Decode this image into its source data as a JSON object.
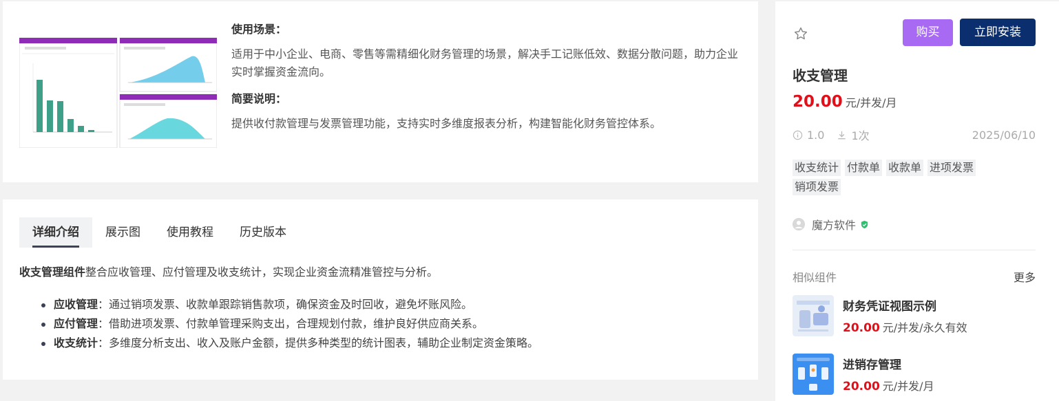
{
  "usage": {
    "scene_title": "使用场景：",
    "scene_text": "适用于中小企业、电商、零售等需精细化财务管理的场景，解决手工记账低效、数据分散问题，助力企业实时掌握资金流向。",
    "brief_title": "简要说明：",
    "brief_text": "提供收付款管理与发票管理功能，支持实时多维度报表分析，构建智能化财务管控体系。"
  },
  "tabs": [
    {
      "label": "详细介绍",
      "active": true
    },
    {
      "label": "展示图",
      "active": false
    },
    {
      "label": "使用教程",
      "active": false
    },
    {
      "label": "历史版本",
      "active": false
    }
  ],
  "detail": {
    "intro_bold": "收支管理组件",
    "intro_rest": "整合应收管理、应付管理及收支统计，实现企业资金流精准管控与分析。",
    "bullets": [
      {
        "bold": "应收管理",
        "text": "：通过销项发票、收款单跟踪销售款项，确保资金及时回收，避免坏账风险。"
      },
      {
        "bold": "应付管理",
        "text": "：借助进项发票、付款单管理采购支出，合理规划付款，维护良好供应商关系。"
      },
      {
        "bold": "收支统计",
        "text": "：多维度分析支出、收入及账户金额，提供多种类型的统计图表，辅助企业制定资金策略。"
      }
    ]
  },
  "product": {
    "buy_label": "购买",
    "install_label": "立即安装",
    "title": "收支管理",
    "price": "20.00",
    "unit": "元/并发/月",
    "version": "1.0",
    "downloads": "1次",
    "date": "2025/06/10",
    "tags": [
      "收支统计",
      "付款单",
      "收款单",
      "进项发票",
      "销项发票"
    ],
    "vendor": "魔方软件"
  },
  "similar": {
    "label": "相似组件",
    "more": "更多",
    "items": [
      {
        "title": "财务凭证视图示例",
        "price": "20.00",
        "unit": "元/并发/永久有效"
      },
      {
        "title": "进销存管理",
        "price": "20.00",
        "unit": "元/并发/月"
      }
    ]
  },
  "colors": {
    "accent_purple": "#a86af3",
    "primary_navy": "#0b2e6e",
    "price_red": "#e0101b",
    "verified_green": "#2fbf71"
  }
}
